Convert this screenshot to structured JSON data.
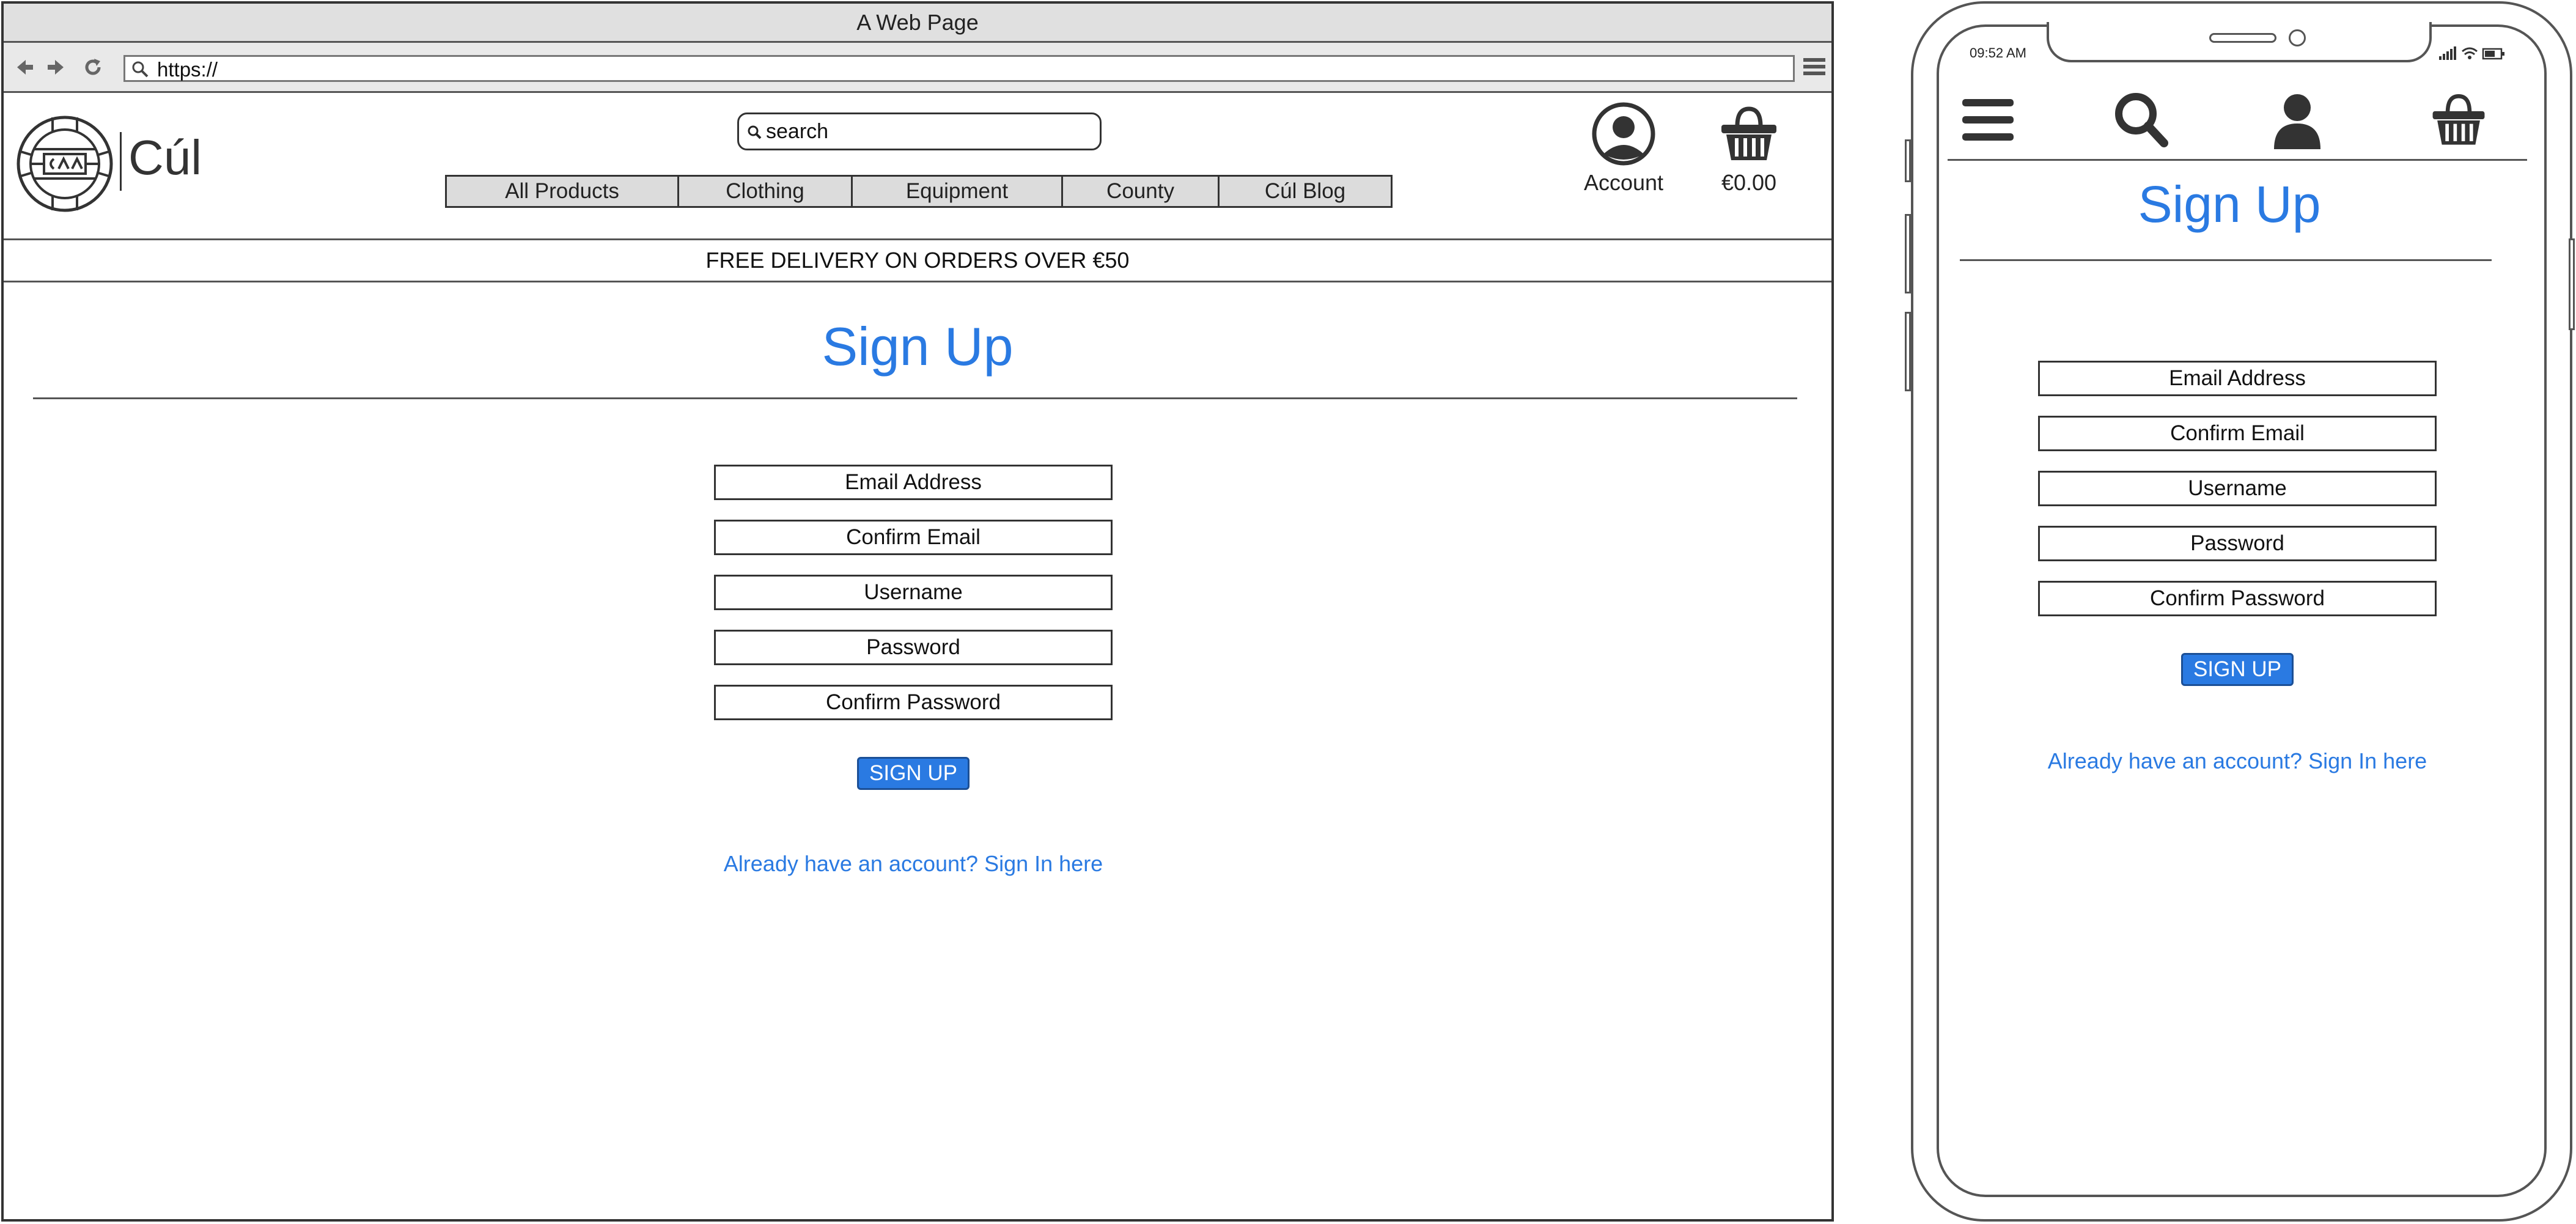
{
  "browser": {
    "window_title": "A Web Page",
    "url": "https://"
  },
  "site": {
    "brand_name": "Cúl",
    "search_placeholder": "search",
    "nav": [
      "All Products",
      "Clothing",
      "Equipment",
      "County",
      "Cúl Blog"
    ],
    "account_label": "Account",
    "cart_total": "€0.00",
    "delivery_banner": "FREE DELIVERY ON ORDERS OVER €50"
  },
  "signup": {
    "title": "Sign Up",
    "fields": [
      "Email Address",
      "Confirm Email",
      "Username",
      "Password",
      "Confirm Password"
    ],
    "button_label": "SIGN UP",
    "signin_link": "Already have an account? Sign In here"
  },
  "mobile": {
    "time": "09:52 AM",
    "icons": [
      "menu-icon",
      "search-icon",
      "account-icon",
      "basket-icon"
    ]
  },
  "colors": {
    "accent": "#2a7ae2",
    "nav_bg": "#dcdcdc",
    "chrome_bg": "#e0e0e0",
    "border": "#333333"
  }
}
